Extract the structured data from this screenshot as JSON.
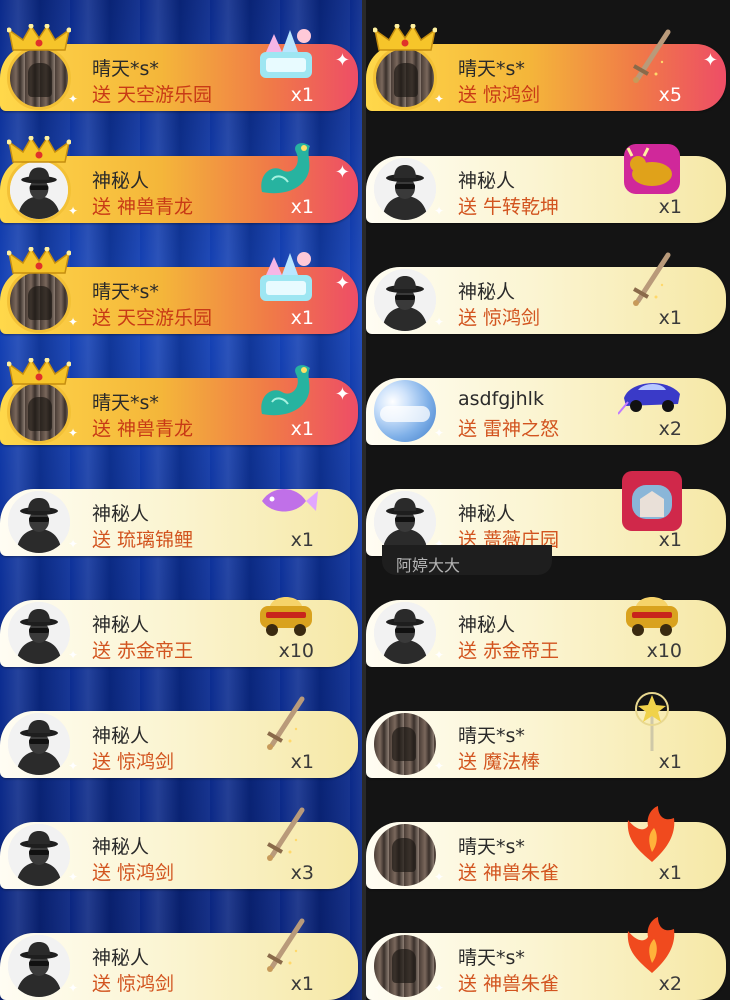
{
  "left_column": [
    {
      "user": "晴天*s*",
      "action": "送 天空游乐园",
      "count": "x1",
      "vip": true,
      "avatar": "photo",
      "gift_icon": "amusement-park-gift-icon",
      "gift_color": "#9ee6f2"
    },
    {
      "user": "神秘人",
      "action": "送 神兽青龙",
      "count": "x1",
      "vip": true,
      "avatar": "mystery",
      "gift_icon": "dragon-gift-icon",
      "gift_color": "#27b3a0"
    },
    {
      "user": "晴天*s*",
      "action": "送 天空游乐园",
      "count": "x1",
      "vip": true,
      "avatar": "photo",
      "gift_icon": "amusement-park-gift-icon",
      "gift_color": "#9ee6f2"
    },
    {
      "user": "晴天*s*",
      "action": "送 神兽青龙",
      "count": "x1",
      "vip": true,
      "avatar": "photo",
      "gift_icon": "dragon-gift-icon",
      "gift_color": "#27b3a0"
    },
    {
      "user": "神秘人",
      "action": "送 琉璃锦鲤",
      "count": "x1",
      "vip": false,
      "avatar": "mystery",
      "gift_icon": "koi-fish-gift-icon",
      "gift_color": "#c070e8"
    },
    {
      "user": "神秘人",
      "action": "送 赤金帝王",
      "count": "x10",
      "vip": false,
      "avatar": "mystery",
      "gift_icon": "golden-car-gift-icon",
      "gift_color": "#d9a21e"
    },
    {
      "user": "神秘人",
      "action": "送 惊鸿剑",
      "count": "x1",
      "vip": false,
      "avatar": "mystery",
      "gift_icon": "sword-gift-icon",
      "gift_color": "#b99a7a"
    },
    {
      "user": "神秘人",
      "action": "送 惊鸿剑",
      "count": "x3",
      "vip": false,
      "avatar": "mystery",
      "gift_icon": "sword-gift-icon",
      "gift_color": "#b99a7a"
    },
    {
      "user": "神秘人",
      "action": "送 惊鸿剑",
      "count": "x1",
      "vip": false,
      "avatar": "mystery",
      "gift_icon": "sword-gift-icon",
      "gift_color": "#b99a7a"
    }
  ],
  "right_column": [
    {
      "user": "晴天*s*",
      "action": "送 惊鸿剑",
      "count": "x5",
      "vip": true,
      "avatar": "photo",
      "gift_icon": "sword-gift-icon",
      "gift_color": "#b99a7a"
    },
    {
      "user": "神秘人",
      "action": "送 牛转乾坤",
      "count": "x1",
      "vip": false,
      "avatar": "mystery",
      "gift_icon": "golden-bull-gift-icon",
      "gift_color": "#e0a21a"
    },
    {
      "user": "神秘人",
      "action": "送 惊鸿剑",
      "count": "x1",
      "vip": false,
      "avatar": "mystery",
      "gift_icon": "sword-gift-icon",
      "gift_color": "#b99a7a"
    },
    {
      "user": "asdfgjhlk",
      "action": "送 雷神之怒",
      "count": "x2",
      "vip": false,
      "avatar": "sky",
      "gift_icon": "sports-car-gift-icon",
      "gift_color": "#3a3ac8"
    },
    {
      "user": "神秘人",
      "action": "送 蔷薇庄园",
      "count": "x1",
      "vip": false,
      "avatar": "mystery",
      "gift_icon": "rose-manor-gift-icon",
      "gift_color": "#d0284a"
    },
    {
      "user": "神秘人",
      "action": "送 赤金帝王",
      "count": "x10",
      "vip": false,
      "avatar": "mystery",
      "gift_icon": "golden-car-gift-icon",
      "gift_color": "#d9a21e"
    },
    {
      "user": "晴天*s*",
      "action": "送 魔法棒",
      "count": "x1",
      "vip": false,
      "avatar": "photo",
      "gift_icon": "magic-wand-gift-icon",
      "gift_color": "#f0d24a"
    },
    {
      "user": "晴天*s*",
      "action": "送 神兽朱雀",
      "count": "x1",
      "vip": false,
      "avatar": "photo",
      "gift_icon": "phoenix-gift-icon",
      "gift_color": "#f04a1e"
    },
    {
      "user": "晴天*s*",
      "action": "送 神兽朱雀",
      "count": "x2",
      "vip": false,
      "avatar": "photo",
      "gift_icon": "phoenix-gift-icon",
      "gift_color": "#f04a1e"
    }
  ],
  "overlay_tag": "阿婷大大"
}
